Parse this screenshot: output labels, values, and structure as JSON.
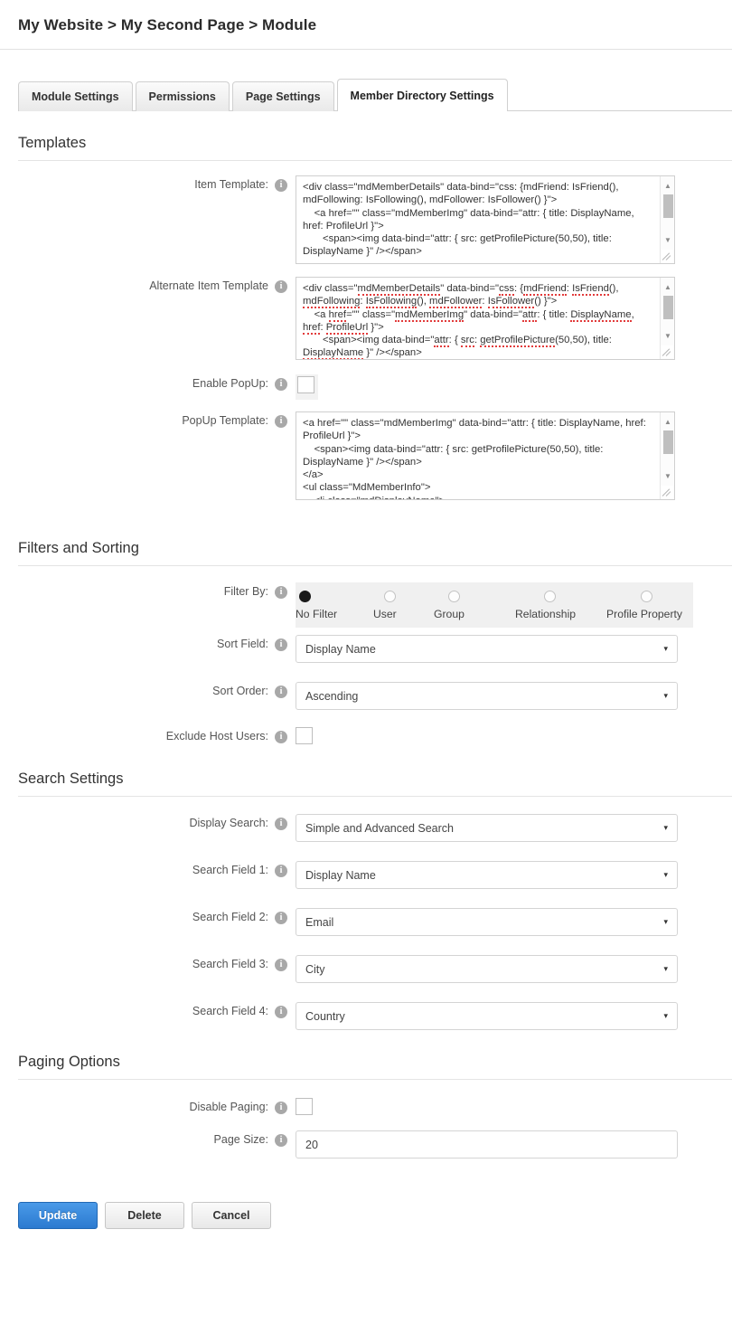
{
  "breadcrumb": {
    "text": "My Website > My Second Page > Module"
  },
  "tabs": [
    {
      "label": "Module Settings",
      "active": false
    },
    {
      "label": "Permissions",
      "active": false
    },
    {
      "label": "Page Settings",
      "active": false
    },
    {
      "label": "Member Directory Settings",
      "active": true
    }
  ],
  "sections": {
    "templates": {
      "heading": "Templates",
      "item_template": {
        "label": "Item Template:",
        "value": "<div class=\"mdMemberDetails\" data-bind=\"css: {mdFriend: IsFriend(), mdFollowing: IsFollowing(), mdFollower: IsFollower() }\">\n    <a href=\"\" class=\"mdMemberImg\" data-bind=\"attr: { title: DisplayName, href: ProfileUrl }\">\n       <span><img data-bind=\"attr: { src: getProfilePicture(50,50), title: DisplayName }\" /></span>"
      },
      "alternate_item_template": {
        "label": "Alternate Item Template",
        "value": "<div class=\"mdMemberDetails\" data-bind=\"css: {mdFriend: IsFriend(), mdFollowing: IsFollowing(), mdFollower: IsFollower() }\">\n    <a href=\"\" class=\"mdMemberImg\" data-bind=\"attr: { title: DisplayName, href: ProfileUrl }\">\n       <span><img data-bind=\"attr: { src: getProfilePicture(50,50), title: DisplayName }\" /></span>"
      },
      "enable_popup": {
        "label": "Enable PopUp:",
        "checked": false
      },
      "popup_template": {
        "label": "PopUp Template:",
        "value": "<a href=\"\" class=\"mdMemberImg\" data-bind=\"attr: { title: DisplayName, href: ProfileUrl }\">\n    <span><img data-bind=\"attr: { src: getProfilePicture(50,50), title: DisplayName }\" /></span>\n</a>\n<ul class=\"MdMemberInfo\">\n    <li class=\"mdDisplayName\">"
      }
    },
    "filters_and_sorting": {
      "heading": "Filters and Sorting",
      "filter_by": {
        "label": "Filter By:",
        "options": [
          "No Filter",
          "User",
          "Group",
          "Relationship",
          "Profile Property"
        ],
        "selected": "No Filter"
      },
      "sort_field": {
        "label": "Sort Field:",
        "value": "Display Name"
      },
      "sort_order": {
        "label": "Sort Order:",
        "value": "Ascending"
      },
      "exclude_host_users": {
        "label": "Exclude Host Users:",
        "checked": false
      }
    },
    "search_settings": {
      "heading": "Search Settings",
      "display_search": {
        "label": "Display Search:",
        "value": "Simple and Advanced Search"
      },
      "search_field_1": {
        "label": "Search Field 1:",
        "value": "Display Name"
      },
      "search_field_2": {
        "label": "Search Field 2:",
        "value": "Email"
      },
      "search_field_3": {
        "label": "Search Field 3:",
        "value": "City"
      },
      "search_field_4": {
        "label": "Search Field 4:",
        "value": "Country"
      }
    },
    "paging_options": {
      "heading": "Paging Options",
      "disable_paging": {
        "label": "Disable Paging:",
        "checked": false
      },
      "page_size": {
        "label": "Page Size:",
        "value": "20"
      }
    }
  },
  "footer_buttons": {
    "update": "Update",
    "delete": "Delete",
    "cancel": "Cancel"
  },
  "icons": {
    "info": "i",
    "caret_down": "▾",
    "scroll_up": "▲",
    "scroll_down": "▼"
  },
  "colors": {
    "primary_button": "#2b7ad0",
    "radio_group_bg": "#f0f0f0",
    "info_icon": "#a8a8a8"
  }
}
